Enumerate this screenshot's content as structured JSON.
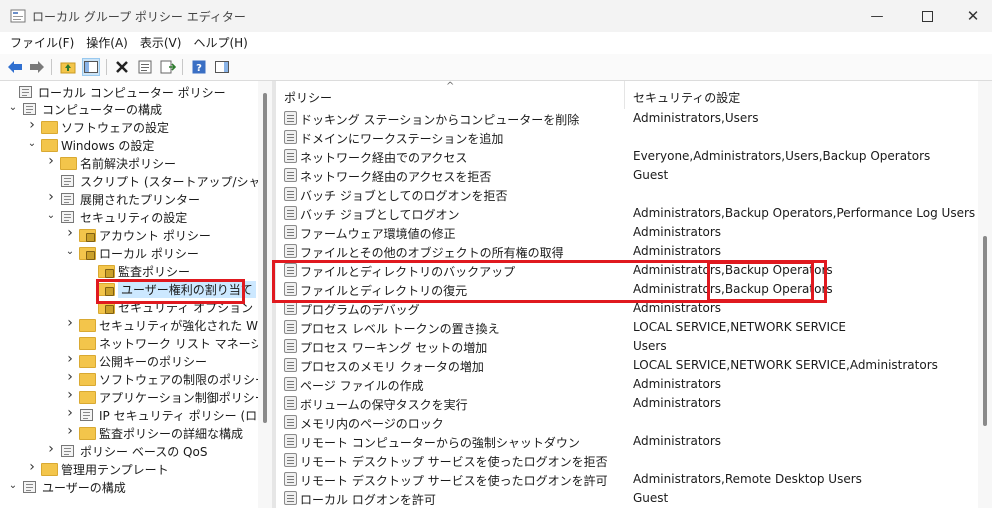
{
  "window": {
    "title": "ローカル グループ ポリシー エディター"
  },
  "menu": [
    "ファイル(F)",
    "操作(A)",
    "表示(V)",
    "ヘルプ(H)"
  ],
  "toolbar": [
    "back-icon",
    "forward-icon",
    "up-folder-icon",
    "show-hide-tree-icon",
    "delete-icon",
    "properties-icon",
    "export-list-icon",
    "help-icon",
    "action-pane-icon"
  ],
  "tree": [
    {
      "label": "ローカル コンピューター ポリシー",
      "icon": "policy-doc-icon",
      "chev": ""
    },
    {
      "label": "コンピューターの構成",
      "icon": "computer-icon",
      "chev": "v"
    },
    {
      "label": "ソフトウェアの設定",
      "icon": "folder-icon",
      "chev": ">"
    },
    {
      "label": "Windows の設定",
      "icon": "folder-icon",
      "chev": "v"
    },
    {
      "label": "名前解決ポリシー",
      "icon": "folder-icon",
      "chev": ">"
    },
    {
      "label": "スクリプト (スタートアップ/シャットダウ",
      "icon": "script-icon",
      "chev": ""
    },
    {
      "label": "展開されたプリンター",
      "icon": "printer-icon",
      "chev": ">"
    },
    {
      "label": "セキュリティの設定",
      "icon": "security-icon",
      "chev": "v"
    },
    {
      "label": "アカウント ポリシー",
      "icon": "secure-folder-icon",
      "chev": ">"
    },
    {
      "label": "ローカル ポリシー",
      "icon": "secure-folder-icon",
      "chev": "v"
    },
    {
      "label": "監査ポリシー",
      "icon": "secure-folder-icon",
      "chev": ""
    },
    {
      "label": "ユーザー権利の割り当て",
      "icon": "secure-folder-icon",
      "chev": ""
    },
    {
      "label": "セキュリティ オプション",
      "icon": "secure-folder-icon",
      "chev": ""
    },
    {
      "label": "セキュリティが強化された Windo",
      "icon": "folder-icon",
      "chev": ">"
    },
    {
      "label": "ネットワーク リスト マネージャー ポ",
      "icon": "folder-icon",
      "chev": ""
    },
    {
      "label": "公開キーのポリシー",
      "icon": "folder-icon",
      "chev": ">"
    },
    {
      "label": "ソフトウェアの制限のポリシー",
      "icon": "folder-icon",
      "chev": ">"
    },
    {
      "label": "アプリケーション制御ポリシー",
      "icon": "folder-icon",
      "chev": ">"
    },
    {
      "label": "IP セキュリティ ポリシー (ローカル",
      "icon": "ip-security-icon",
      "chev": ">"
    },
    {
      "label": "監査ポリシーの詳細な構成",
      "icon": "folder-icon",
      "chev": ">"
    },
    {
      "label": "ポリシー ベースの QoS",
      "icon": "chart-icon",
      "chev": ">"
    },
    {
      "label": "管理用テンプレート",
      "icon": "folder-icon",
      "chev": ">"
    },
    {
      "label": "ユーザーの構成",
      "icon": "user-icon",
      "chev": "v"
    }
  ],
  "list": {
    "col_policy": "ポリシー",
    "col_setting": "セキュリティの設定",
    "sort_arrow": "^",
    "rows": [
      {
        "policy": "ドッキング ステーションからコンピューターを削除",
        "setting": "Administrators,Users"
      },
      {
        "policy": "ドメインにワークステーションを追加",
        "setting": ""
      },
      {
        "policy": "ネットワーク経由でのアクセス",
        "setting": "Everyone,Administrators,Users,Backup Operators"
      },
      {
        "policy": "ネットワーク経由のアクセスを拒否",
        "setting": "Guest"
      },
      {
        "policy": "バッチ ジョブとしてのログオンを拒否",
        "setting": ""
      },
      {
        "policy": "バッチ ジョブとしてログオン",
        "setting": "Administrators,Backup Operators,Performance Log Users"
      },
      {
        "policy": "ファームウェア環境値の修正",
        "setting": "Administrators"
      },
      {
        "policy": "ファイルとその他のオブジェクトの所有権の取得",
        "setting": "Administrators"
      },
      {
        "policy": "ファイルとディレクトリのバックアップ",
        "setting": "Administrators,Backup Operators"
      },
      {
        "policy": "ファイルとディレクトリの復元",
        "setting": "Administrators,Backup Operators"
      },
      {
        "policy": "プログラムのデバッグ",
        "setting": "Administrators"
      },
      {
        "policy": "プロセス レベル トークンの置き換え",
        "setting": "LOCAL SERVICE,NETWORK SERVICE"
      },
      {
        "policy": "プロセス ワーキング セットの増加",
        "setting": "Users"
      },
      {
        "policy": "プロセスのメモリ クォータの増加",
        "setting": "LOCAL SERVICE,NETWORK SERVICE,Administrators"
      },
      {
        "policy": "ページ ファイルの作成",
        "setting": "Administrators"
      },
      {
        "policy": "ボリュームの保守タスクを実行",
        "setting": "Administrators"
      },
      {
        "policy": "メモリ内のページのロック",
        "setting": ""
      },
      {
        "policy": "リモート コンピューターからの強制シャットダウン",
        "setting": "Administrators"
      },
      {
        "policy": "リモート デスクトップ サービスを使ったログオンを拒否",
        "setting": ""
      },
      {
        "policy": "リモート デスクトップ サービスを使ったログオンを許可",
        "setting": "Administrators,Remote Desktop Users"
      },
      {
        "policy": "ローカル ログオンを許可",
        "setting": "Guest"
      }
    ]
  },
  "colors": {
    "highlight": "#e0191f",
    "folder": "#f3c54b",
    "selection": "#cce8ff"
  }
}
